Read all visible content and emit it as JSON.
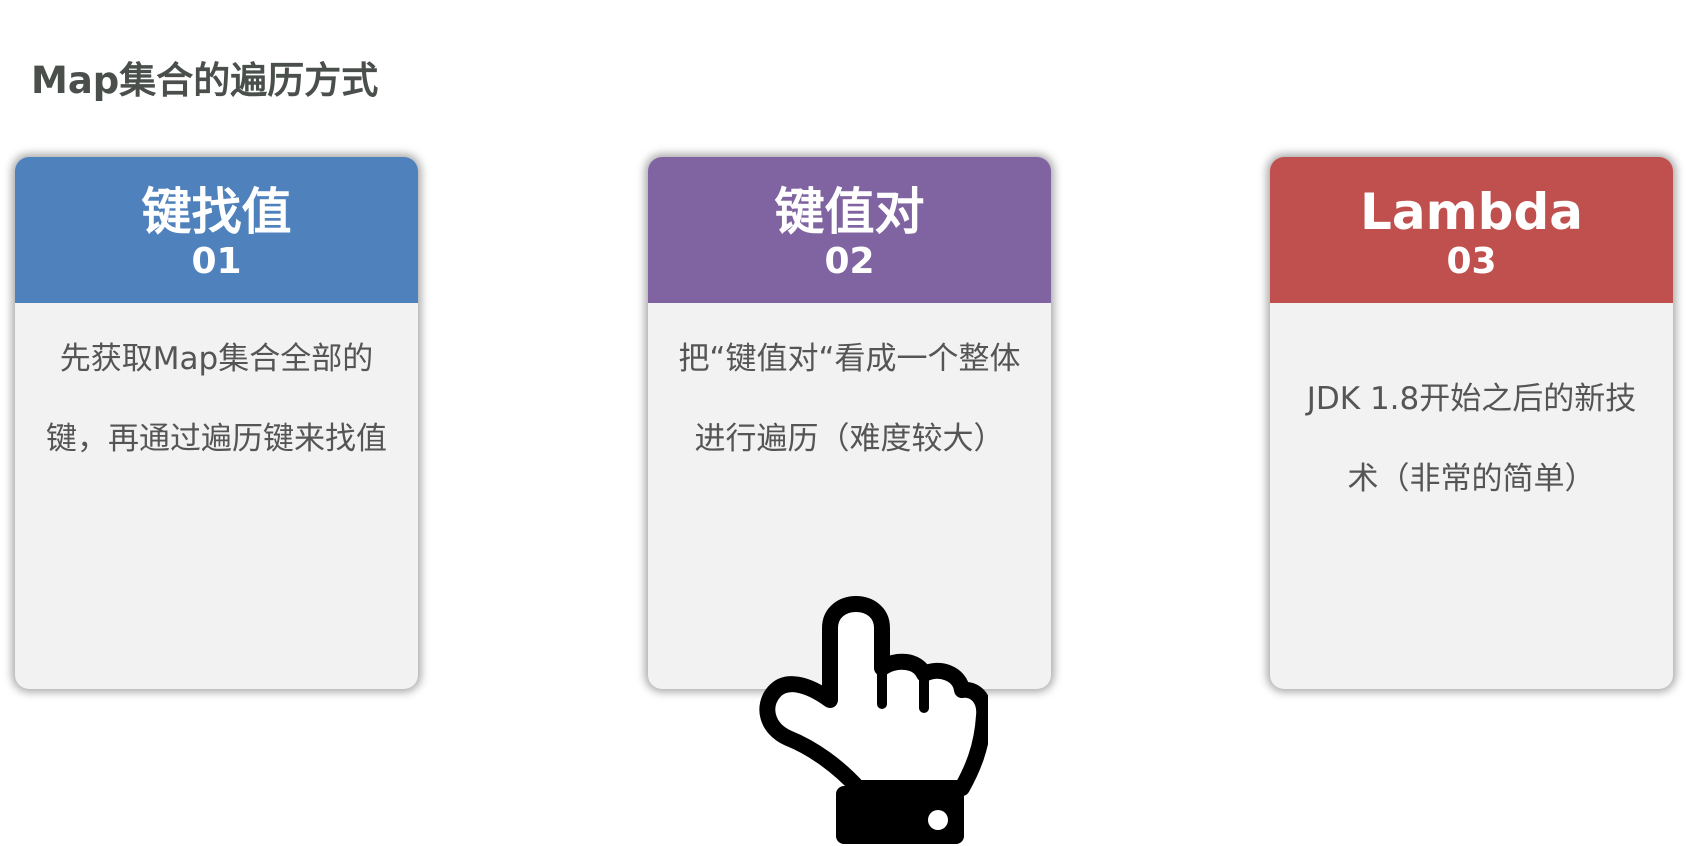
{
  "page": {
    "title": "Map集合的遍历方式"
  },
  "cards": [
    {
      "heading": "键找值",
      "number": "01",
      "description": "先获取Map集合全部的键，再通过遍历键来找值",
      "color": "#4f81bd"
    },
    {
      "heading": "键值对",
      "number": "02",
      "description": "把“键值对“看成一个整体进行遍历（难度较大）",
      "color": "#8064a2"
    },
    {
      "heading": "Lambda",
      "number": "03",
      "description": "JDK 1.8开始之后的新技术（非常的简单）",
      "color": "#c0504d"
    }
  ],
  "icons": {
    "pointer": "pointing-hand-icon"
  }
}
